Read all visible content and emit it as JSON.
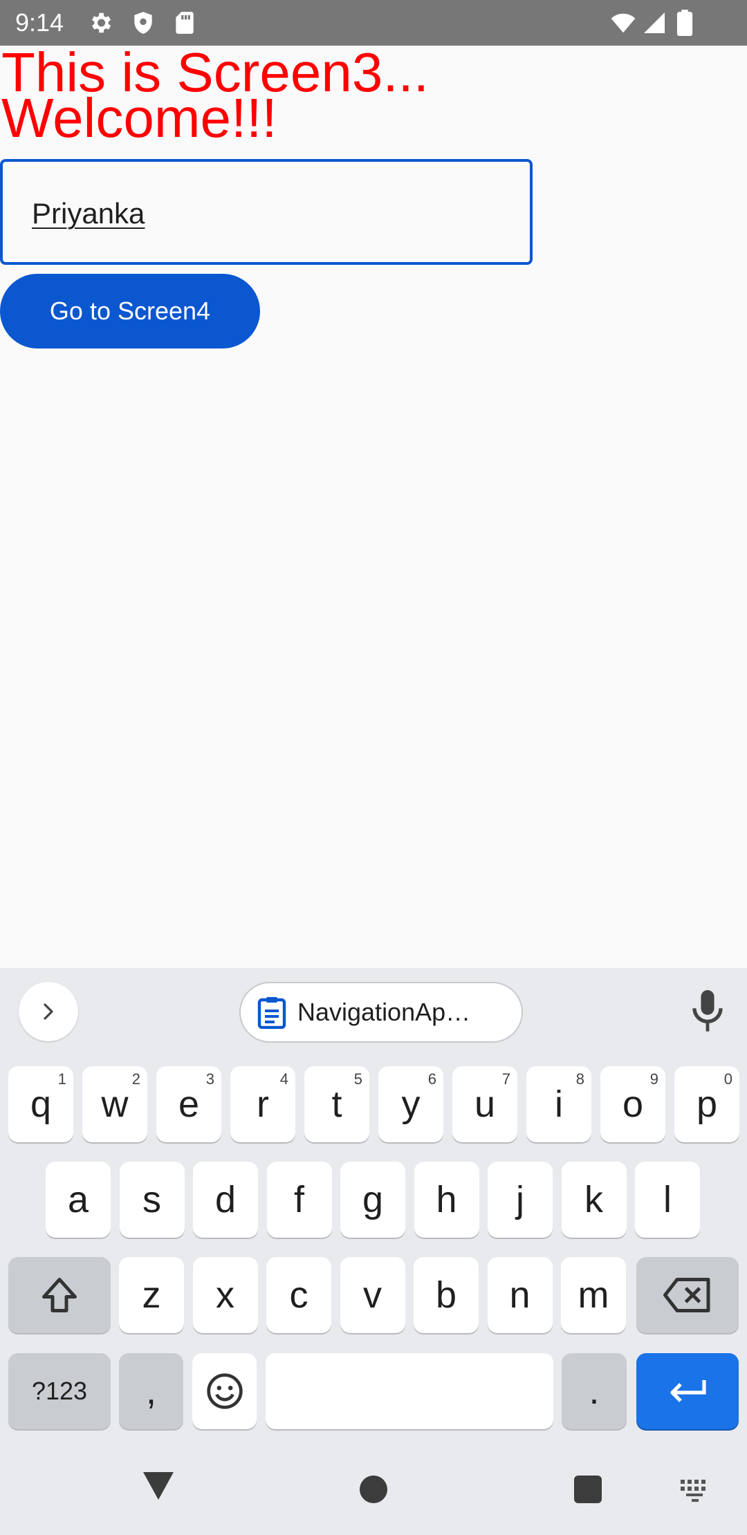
{
  "status_bar": {
    "time": "9:14",
    "left_icons": [
      "gear-icon",
      "shield-icon",
      "sd-card-icon"
    ],
    "right_icons": [
      "wifi-icon",
      "cell-signal-icon",
      "battery-icon"
    ]
  },
  "screen": {
    "headline_line1": "This is Screen3...",
    "headline_line2": "Welcome!!!",
    "headline_color": "#ff0000",
    "name_field_value": "Priyanka",
    "button_label": "Go to Screen4",
    "accent_color": "#0b57d0"
  },
  "keyboard": {
    "clipboard_chip": "NavigationAp…",
    "row1": [
      {
        "key": "q",
        "hint": "1"
      },
      {
        "key": "w",
        "hint": "2"
      },
      {
        "key": "e",
        "hint": "3"
      },
      {
        "key": "r",
        "hint": "4"
      },
      {
        "key": "t",
        "hint": "5"
      },
      {
        "key": "y",
        "hint": "6"
      },
      {
        "key": "u",
        "hint": "7"
      },
      {
        "key": "i",
        "hint": "8"
      },
      {
        "key": "o",
        "hint": "9"
      },
      {
        "key": "p",
        "hint": "0"
      }
    ],
    "row2": [
      "a",
      "s",
      "d",
      "f",
      "g",
      "h",
      "j",
      "k",
      "l"
    ],
    "row3": [
      "z",
      "x",
      "c",
      "v",
      "b",
      "n",
      "m"
    ],
    "symbols_label": "?123",
    "comma_label": ",",
    "period_label": ".",
    "enter_color": "#1a73e8"
  }
}
